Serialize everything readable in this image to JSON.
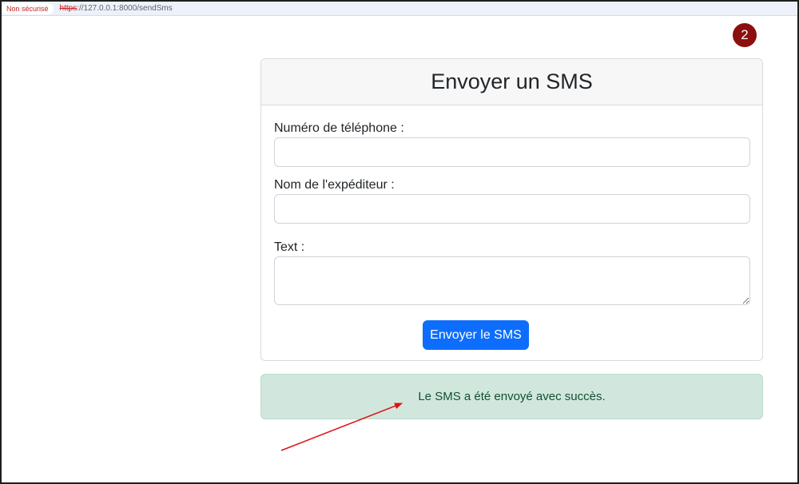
{
  "browser": {
    "security_label": "Non sécurisé",
    "url_scheme": "https",
    "url_rest": "://127.0.0.1:8000/sendSms"
  },
  "step_badge": "2",
  "form": {
    "title": "Envoyer un SMS",
    "phone_label": "Numéro de téléphone :",
    "phone_value": "",
    "sender_label": "Nom de l'expéditeur :",
    "sender_value": "",
    "text_label": "Text :",
    "text_value": "",
    "submit_label": "Envoyer le SMS"
  },
  "alert": {
    "message": "Le SMS a été envoyé avec succès."
  },
  "colors": {
    "primary": "#0d6efd",
    "success_bg": "#d1e7dd",
    "success_text": "#0f5132",
    "badge": "#8b0f0f",
    "arrow": "#e01010"
  }
}
